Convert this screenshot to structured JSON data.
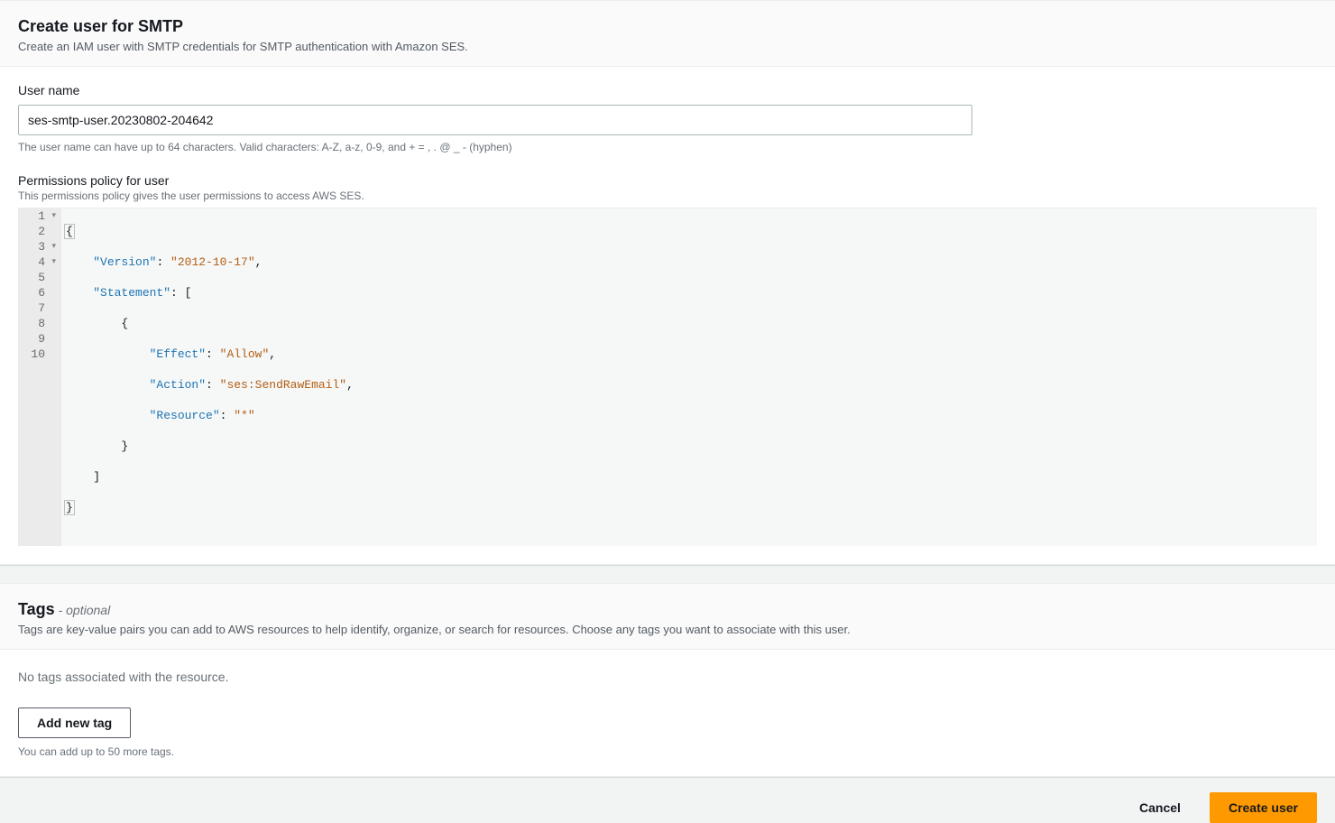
{
  "header": {
    "title": "Create user for SMTP",
    "subtitle": "Create an IAM user with SMTP credentials for SMTP authentication with Amazon SES."
  },
  "username": {
    "label": "User name",
    "value": "ses-smtp-user.20230802-204642",
    "hint": "The user name can have up to 64 characters. Valid characters: A-Z, a-z, 0-9, and + = , . @ _ - (hyphen)"
  },
  "policy": {
    "label": "Permissions policy for user",
    "sub": "This permissions policy gives the user permissions to access AWS SES.",
    "lines": [
      {
        "n": "1",
        "fold": true
      },
      {
        "n": "2",
        "fold": false
      },
      {
        "n": "3",
        "fold": true
      },
      {
        "n": "4",
        "fold": true
      },
      {
        "n": "5",
        "fold": false
      },
      {
        "n": "6",
        "fold": false
      },
      {
        "n": "7",
        "fold": false
      },
      {
        "n": "8",
        "fold": false
      },
      {
        "n": "9",
        "fold": false
      },
      {
        "n": "10",
        "fold": false
      }
    ],
    "tokens": {
      "l1": "{",
      "l2k": "\"Version\"",
      "l2p": ": ",
      "l2v": "\"2012-10-17\"",
      "l2e": ",",
      "l3k": "\"Statement\"",
      "l3p": ": [",
      "l4": "{",
      "l5k": "\"Effect\"",
      "l5p": ": ",
      "l5v": "\"Allow\"",
      "l5e": ",",
      "l6k": "\"Action\"",
      "l6p": ": ",
      "l6v": "\"ses:SendRawEmail\"",
      "l6e": ",",
      "l7k": "\"Resource\"",
      "l7p": ": ",
      "l7v": "\"*\"",
      "l8": "}",
      "l9": "]",
      "l10": "}"
    }
  },
  "tags": {
    "title": "Tags",
    "dash": " - ",
    "optional": "optional",
    "sub": "Tags are key-value pairs you can add to AWS resources to help identify, organize, or search for resources. Choose any tags you want to associate with this user.",
    "empty": "No tags associated with the resource.",
    "add_label": "Add new tag",
    "limit_hint": "You can add up to 50 more tags."
  },
  "footer": {
    "cancel": "Cancel",
    "create": "Create user"
  }
}
